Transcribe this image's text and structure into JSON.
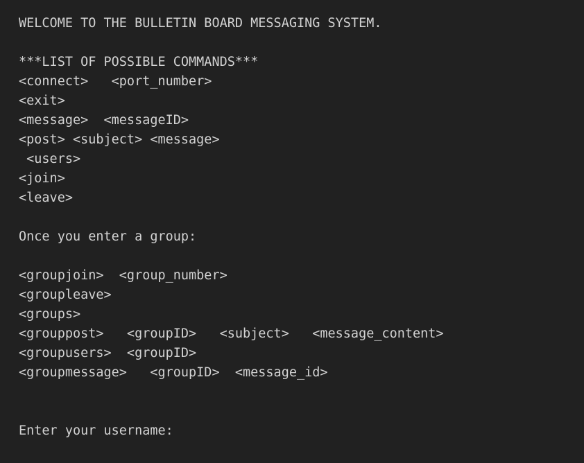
{
  "terminal": {
    "title": "Bulletin Board Messaging System",
    "background_color": "#212121",
    "text_color": "#d2d2d2",
    "welcome_message": "WELCOME TO THE BULLETIN BOARD MESSAGING SYSTEM.",
    "commands_header": "***LIST OF POSSIBLE COMMANDS***",
    "global_commands": [
      "<connect>   <port_number>",
      "<exit>",
      "<message>  <messageID>",
      "<post> <subject> <message>",
      " <users>",
      "<join>",
      "<leave>"
    ],
    "group_section_header": "Once you enter a group:",
    "group_commands": [
      "<groupjoin>  <group_number>",
      "<groupleave>",
      "<groups>",
      "<grouppost>   <groupID>   <subject>   <message_content>",
      "<groupusers>  <groupID>",
      "<groupmessage>   <groupID>  <message_id>"
    ],
    "prompt": "Enter your username:",
    "input_value": ""
  }
}
